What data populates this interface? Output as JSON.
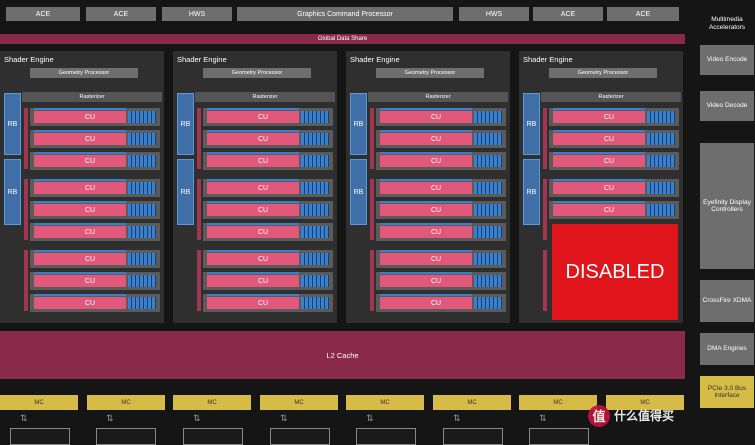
{
  "top_blocks": {
    "ace1": "ACE",
    "ace2": "ACE",
    "hws1": "HWS",
    "gcp": "Graphics Command Processor",
    "hws2": "HWS",
    "ace3": "ACE",
    "ace4": "ACE"
  },
  "global_data_share": "Global Data Share",
  "shader_engines": [
    {
      "title": "Shader Engine",
      "geometry": "Geometry Processor",
      "rasterizer": "Rasterizer",
      "rb": [
        "RB",
        "RB"
      ]
    },
    {
      "title": "Shader Engine",
      "geometry": "Geometry Processor",
      "rasterizer": "Rasterizer",
      "rb": [
        "RB",
        "RB"
      ]
    },
    {
      "title": "Shader Engine",
      "geometry": "Geometry Processor",
      "rasterizer": "Rasterizer",
      "rb": [
        "RB",
        "RB"
      ]
    },
    {
      "title": "Shader Engine",
      "geometry": "Geometry Processor",
      "rasterizer": "Rasterizer",
      "rb": [
        "RB",
        "RB"
      ]
    }
  ],
  "cu_label": "CU",
  "disabled_label": "DISABLED",
  "l2_cache": "L2 Cache",
  "mc_label": "MC",
  "right_column": {
    "multimedia": "Multimedia Accelerators",
    "video_encode": "Video Encode",
    "video_decode": "Video Decode",
    "eyefinity": "Eyefinity Display Controllers",
    "crossfire": "CrossFire XDMA",
    "dma": "DMA Engines",
    "pcie": "PCIe 3.0 Bus Interface"
  },
  "watermark": {
    "logo": "值",
    "text": "什么值得买"
  },
  "colors": {
    "cu_pink": "#e2587a",
    "cu_blue": "#3a80d0",
    "disabled_red": "#e0141b",
    "cache": "#8a2a4a",
    "mc_gold": "#d6bc47"
  }
}
